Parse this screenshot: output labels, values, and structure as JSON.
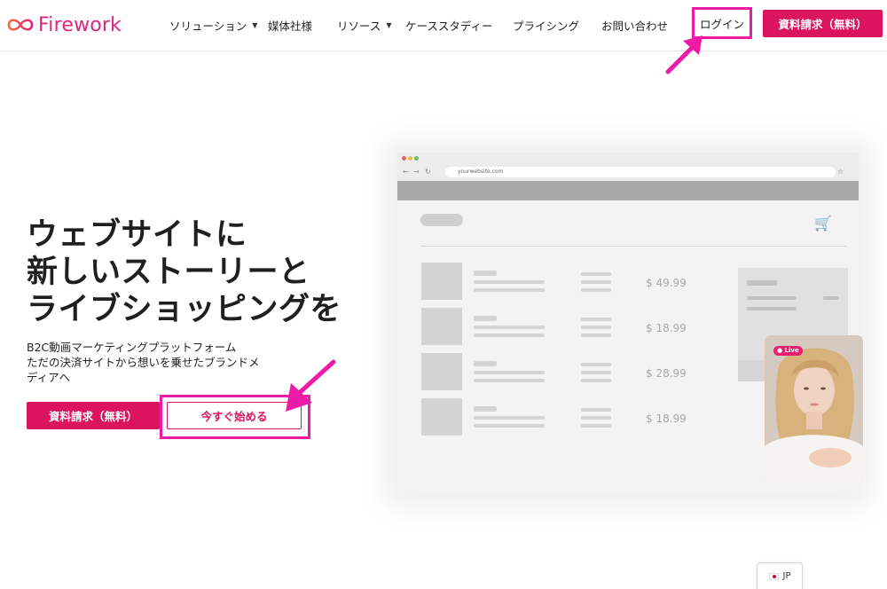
{
  "brand": {
    "name": "Firework",
    "color": "#e0237f"
  },
  "nav": {
    "items": [
      {
        "label": "ソリューション",
        "has_dropdown": true
      },
      {
        "label": "媒体社様",
        "has_dropdown": false
      },
      {
        "label": "リソース",
        "has_dropdown": true
      },
      {
        "label": "ケーススタディー",
        "has_dropdown": false
      },
      {
        "label": "プライシング",
        "has_dropdown": false
      },
      {
        "label": "お問い合わせ",
        "has_dropdown": false
      }
    ],
    "dropdown_glyph": "▼",
    "login_label": "ログイン",
    "cta_label": "資料請求（無料）"
  },
  "hero": {
    "title_lines": [
      "ウェブサイトに",
      "新しいストーリーと",
      "ライブショッピングを"
    ],
    "subtitle_lines": [
      "B2C動画マーケティングプラットフォーム",
      "ただの決済サイトから想いを乗せたブランドメ",
      "ディアへ"
    ],
    "primary_button": "資料請求（無料）",
    "secondary_button": "今すぐ始める"
  },
  "mockup": {
    "url": "yourwebsite.com",
    "prices": [
      "$ 49.99",
      "$ 18.99",
      "$ 28.99",
      "$ 18.99"
    ],
    "live_badge": "● Live",
    "cart_icon": "cart-icon"
  },
  "language": {
    "label": "JP"
  },
  "colors": {
    "accent": "#dc145f",
    "highlight": "#ef1aa6"
  }
}
